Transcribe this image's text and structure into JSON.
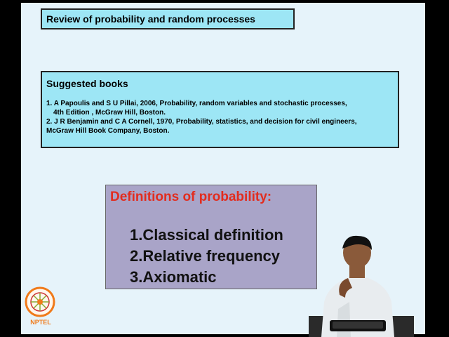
{
  "slide": {
    "title": "Review of probability and random processes",
    "books": {
      "heading": "Suggested books",
      "lines": [
        "1.    A Papoulis and S U Pillai, 2006, Probability, random variables and stochastic processes,",
        "4th Edition , McGraw Hill, Boston.",
        "2. J R Benjamin and C A Cornell, 1970, Probability, statistics, and decision for civil engineers,",
        "McGraw Hill Book Company, Boston."
      ]
    },
    "definitions": {
      "heading": "Definitions of probability:",
      "items": [
        "1.Classical definition",
        "2.Relative frequency",
        "3.Axiomatic"
      ]
    }
  },
  "logo": {
    "text": "NPTEL",
    "icon": "nptel-logo-icon",
    "color": "#f07a1a"
  },
  "colors": {
    "slide_bg": "#e6f3fa",
    "box_bg": "#9de6f5",
    "defs_bg": "#a9a4c8",
    "defs_heading": "#e22c1e"
  }
}
